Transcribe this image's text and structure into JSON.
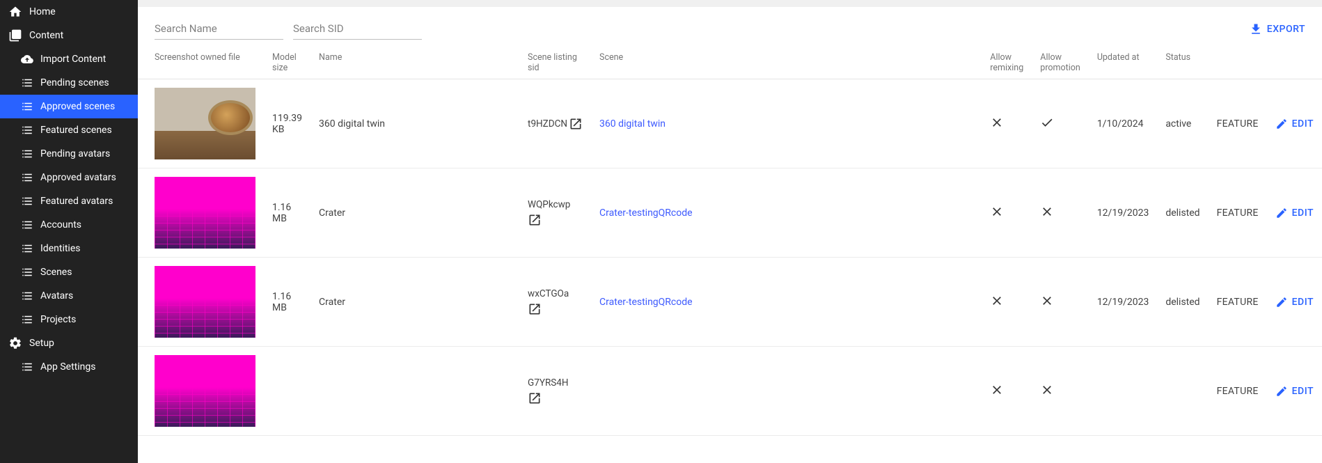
{
  "sidebar": {
    "top": [
      {
        "label": "Home",
        "icon": "home"
      },
      {
        "label": "Content",
        "icon": "book"
      }
    ],
    "content_items": [
      {
        "label": "Import Content",
        "icon": "cloud"
      },
      {
        "label": "Pending scenes",
        "icon": "list"
      },
      {
        "label": "Approved scenes",
        "icon": "list",
        "active": true
      },
      {
        "label": "Featured scenes",
        "icon": "list"
      },
      {
        "label": "Pending avatars",
        "icon": "list"
      },
      {
        "label": "Approved avatars",
        "icon": "list"
      },
      {
        "label": "Featured avatars",
        "icon": "list"
      },
      {
        "label": "Accounts",
        "icon": "list"
      },
      {
        "label": "Identities",
        "icon": "list"
      },
      {
        "label": "Scenes",
        "icon": "list"
      },
      {
        "label": "Avatars",
        "icon": "list"
      },
      {
        "label": "Projects",
        "icon": "list"
      }
    ],
    "setup": {
      "label": "Setup",
      "items": [
        {
          "label": "App Settings",
          "icon": "list"
        }
      ]
    }
  },
  "toolbar": {
    "search_name_placeholder": "Search Name",
    "search_sid_placeholder": "Search SID",
    "export_label": "EXPORT"
  },
  "columns": {
    "screenshot": "Screenshot owned file",
    "model_size": "Model size",
    "name": "Name",
    "sid": "Scene listing sid",
    "scene": "Scene",
    "allow_remixing": "Allow remixing",
    "allow_promotion": "Allow promotion",
    "updated_at": "Updated at",
    "status": "Status"
  },
  "row_labels": {
    "feature": "FEATURE",
    "edit": "EDIT"
  },
  "rows": [
    {
      "thumb": "gallery",
      "model_size": "119.39 KB",
      "name": "360 digital twin",
      "sid": "t9HZDCN",
      "sid_layout": "inline",
      "scene": "360 digital twin",
      "allow_remixing": false,
      "allow_promotion": true,
      "updated_at": "1/10/2024",
      "status": "active"
    },
    {
      "thumb": "crater",
      "model_size": "1.16 MB",
      "name": "Crater",
      "sid": "WQPkcwp",
      "sid_layout": "stacked",
      "scene": "Crater-testingQRcode",
      "allow_remixing": false,
      "allow_promotion": false,
      "updated_at": "12/19/2023",
      "status": "delisted"
    },
    {
      "thumb": "crater",
      "model_size": "1.16 MB",
      "name": "Crater",
      "sid": "wxCTGOa",
      "sid_layout": "stacked",
      "scene": "Crater-testingQRcode",
      "allow_remixing": false,
      "allow_promotion": false,
      "updated_at": "12/19/2023",
      "status": "delisted"
    },
    {
      "thumb": "crater",
      "model_size": "",
      "name": "",
      "sid": "G7YRS4H",
      "sid_layout": "stacked",
      "scene": "",
      "allow_remixing": false,
      "allow_promotion": false,
      "updated_at": "",
      "status": ""
    }
  ]
}
